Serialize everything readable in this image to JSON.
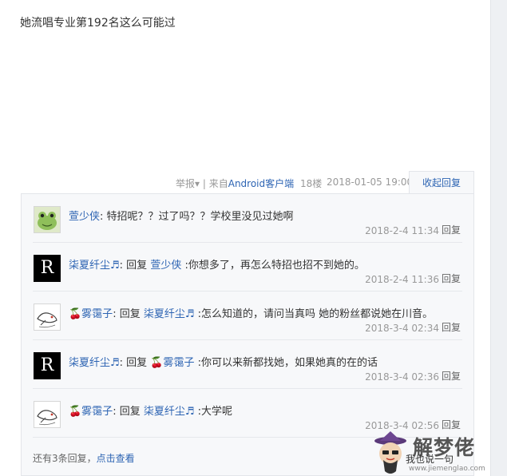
{
  "post": {
    "text": "她流唱专业第192名这么可能过",
    "report": "举报",
    "report_caret": "▾",
    "sep": " | ",
    "from_prefix": "来自",
    "from_client": "Android客户端",
    "floor": "18楼",
    "datetime": "2018-01-05 19:00",
    "collapse_label": "收起回复"
  },
  "replies": [
    {
      "user": "萱少侠",
      "user_suffix": ":",
      "text": " 特招呢？？过了吗？？学校里没见过她啊",
      "time": "2018-2-4 11:34",
      "reply_label": "回复",
      "avatar": "frog-avatar"
    },
    {
      "user": "柒夏纤尘♬",
      "reply_word": ": 回复 ",
      "target": "萱少侠",
      "text": " :你想多了，再怎么特招也招不到她的。",
      "time": "2018-2-4 11:36",
      "reply_label": "回复",
      "avatar": "R"
    },
    {
      "user": "🍒雾霭子",
      "reply_word": ": 回复 ",
      "target": "柒夏纤尘♬",
      "text": " :怎么知道的，请问当真吗 她的粉丝都说她在川音。",
      "time": "2018-3-4 02:34",
      "reply_label": "回复",
      "avatar": "fish-avatar"
    },
    {
      "user": "柒夏纤尘♬",
      "reply_word": ": 回复 ",
      "target": "🍒雾霭子",
      "text": " :你可以来新都找她，如果她真的在的话",
      "time": "2018-3-4 02:36",
      "reply_label": "回复",
      "avatar": "R"
    },
    {
      "user": "🍒雾霭子",
      "reply_word": ": 回复 ",
      "target": "柒夏纤尘♬",
      "text": " :大学呢",
      "time": "2018-3-4 02:56",
      "reply_label": "回复",
      "avatar": "fish-avatar"
    }
  ],
  "more": {
    "prefix": "还有3条回复，",
    "link": "点击查看"
  },
  "watermark": {
    "title": "解梦佬",
    "say": "我也说一句",
    "url": "www.jiemenglao.com"
  },
  "colors": {
    "link": "#2d64b3",
    "meta": "#999999",
    "box_bg": "#f7f8fa"
  }
}
